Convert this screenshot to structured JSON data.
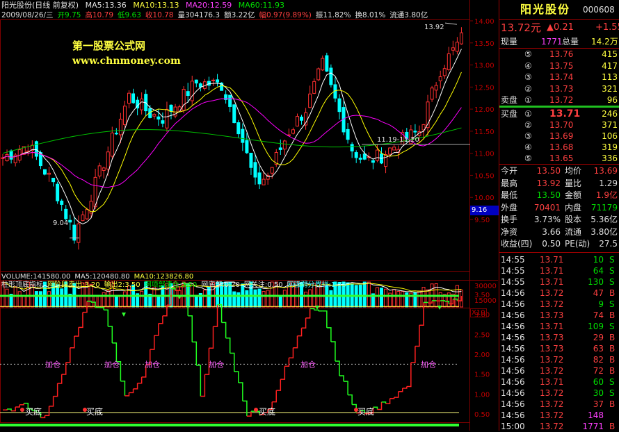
{
  "colors": {
    "up": "#ff3030",
    "down": "#00ffff",
    "ma5": "#ffffff",
    "ma10": "#ffff00",
    "ma20": "#ff00ff",
    "ma60": "#00c000",
    "ind_up": "#ff2020",
    "ind_down": "#20ff20",
    "grid": "#800000",
    "bg": "#000000"
  },
  "header": {
    "line1": {
      "name": "阳光股份(日线 前复权)",
      "ma5": "MA5:13.36",
      "ma10": "MA10:13.13",
      "ma20": "MA20:12.59",
      "ma60": "MA60:11.93"
    },
    "line2": {
      "date": "2009/08/26/三",
      "open": "开9.75",
      "high": "高10.79",
      "low": "低9.63",
      "close": "收10.78",
      "vol": "量304176.3",
      "amt": "额3.22亿",
      "chg": "幅0.97(9.89%)",
      "amp": "振11.82%",
      "turn": "换8.01%",
      "flow": "流通3.80亿"
    }
  },
  "watermark": {
    "title": "第一股票公式网",
    "url": "www.chnmoney.com"
  },
  "price_axis": [
    "14.00",
    "13.50",
    "13.00",
    "12.50",
    "12.00",
    "11.50",
    "11.00",
    "10.50",
    "10.00",
    "9.50"
  ],
  "price_annotations": {
    "high": "13.92",
    "low": "9.04",
    "range": "11.19-11.20",
    "current": "9.16"
  },
  "volume": {
    "label": "VOLUME:141580.00",
    "ma5": "MA5:120480.80",
    "ma10": "MA10:123826.80",
    "axis": [
      "30000",
      "15000"
    ],
    "unit": "X10"
  },
  "indicator": {
    "name": "柱形顶底指标",
    "stage_sell": "网阶段卖出:3.20",
    "output": "输出2:3.50",
    "top_clear": "网项部清仓:3.50",
    "bottom": "网底部:0.20",
    "watch": "网关注:0.50",
    "divide": "网强弱分界线:1.75",
    "axis": [
      "3.50",
      "3.00",
      "2.50",
      "2.00",
      "1.50",
      "1.00",
      "0.50"
    ],
    "add_label": "加仓",
    "buy_label": "买底"
  },
  "quote": {
    "name": "阳光股份",
    "code": "000608",
    "price": "13.72元",
    "change": "▲0.21",
    "change2": "+1.55",
    "current_vol_label": "现量",
    "current_vol": "1771",
    "total_vol_label": "总量",
    "total_vol": "14.2万",
    "sell_label": "卖盘",
    "buy_label": "买盘",
    "asks": [
      {
        "lvl": "⑤",
        "price": "13.76",
        "vol": "415"
      },
      {
        "lvl": "④",
        "price": "13.75",
        "vol": "417"
      },
      {
        "lvl": "③",
        "price": "13.74",
        "vol": "113"
      },
      {
        "lvl": "②",
        "price": "13.73",
        "vol": "321"
      },
      {
        "lvl": "①",
        "price": "13.72",
        "vol": "96"
      }
    ],
    "bids": [
      {
        "lvl": "①",
        "price": "13.71",
        "vol": "246"
      },
      {
        "lvl": "②",
        "price": "13.70",
        "vol": "371"
      },
      {
        "lvl": "③",
        "price": "13.69",
        "vol": "106"
      },
      {
        "lvl": "④",
        "price": "13.68",
        "vol": "319"
      },
      {
        "lvl": "⑤",
        "price": "13.65",
        "vol": "336"
      }
    ],
    "stats": [
      {
        "l1": "今开",
        "v1": "13.50",
        "l2": "均价",
        "v2": "13.69"
      },
      {
        "l1": "最高",
        "v1": "13.92",
        "l2": "量比",
        "v2": "1.29"
      },
      {
        "l1": "最低",
        "v1": "13.50",
        "l2": "金额",
        "v2": "1.9亿"
      },
      {
        "l1": "外盘",
        "v1": "70401",
        "l2": "内盘",
        "v2": "71179"
      },
      {
        "l1": "换手",
        "v1": "3.73%",
        "l2": "股本",
        "v2": "5.36亿"
      },
      {
        "l1": "净资",
        "v1": "3.66",
        "l2": "流通",
        "v2": "3.80亿"
      },
      {
        "l1": "收益(四)",
        "v1": "0.50",
        "l2": "PE(动)",
        "v2": "27.5"
      }
    ],
    "ticks": [
      {
        "t": "14:55",
        "p": "13.71",
        "v": "10",
        "d": "S"
      },
      {
        "t": "14:55",
        "p": "13.71",
        "v": "64",
        "d": "S"
      },
      {
        "t": "14:55",
        "p": "13.71",
        "v": "130",
        "d": "S"
      },
      {
        "t": "14:56",
        "p": "13.72",
        "v": "47",
        "d": "B"
      },
      {
        "t": "14:56",
        "p": "13.72",
        "v": "9",
        "d": "S"
      },
      {
        "t": "14:56",
        "p": "13.73",
        "v": "74",
        "d": "B"
      },
      {
        "t": "14:56",
        "p": "13.71",
        "v": "109",
        "d": "S"
      },
      {
        "t": "14:56",
        "p": "13.73",
        "v": "29",
        "d": "B"
      },
      {
        "t": "14:56",
        "p": "13.73",
        "v": "63",
        "d": "B"
      },
      {
        "t": "14:56",
        "p": "13.72",
        "v": "82",
        "d": "B"
      },
      {
        "t": "14:56",
        "p": "13.72",
        "v": "72",
        "d": "B"
      },
      {
        "t": "14:56",
        "p": "13.71",
        "v": "60",
        "d": "S"
      },
      {
        "t": "14:56",
        "p": "13.72",
        "v": "30",
        "d": "S"
      },
      {
        "t": "14:56",
        "p": "13.72",
        "v": "37",
        "d": "B"
      },
      {
        "t": "14:56",
        "p": "13.72",
        "v": "148",
        "d": ""
      },
      {
        "t": "15:00",
        "p": "13.72",
        "v": "1771",
        "d": "B"
      }
    ]
  }
}
